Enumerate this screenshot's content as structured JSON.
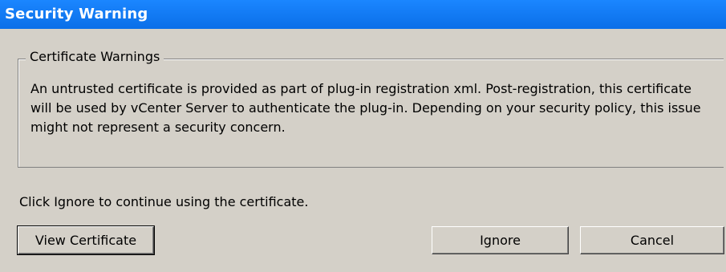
{
  "window": {
    "title": "Security Warning"
  },
  "group": {
    "legend": "Certificate Warnings",
    "message": "An untrusted certificate is provided as part of plug-in registration xml. Post-registration, this certificate will be used by vCenter Server to authenticate the plug-in. Depending on your security policy, this issue might not represent a security concern."
  },
  "instruction": "Click Ignore to continue using the certificate.",
  "buttons": {
    "view_certificate": "View Certificate",
    "ignore": "Ignore",
    "cancel": "Cancel"
  },
  "colors": {
    "titlebar": "#0a6fe8",
    "dialog_background": "#d4d0c8"
  }
}
